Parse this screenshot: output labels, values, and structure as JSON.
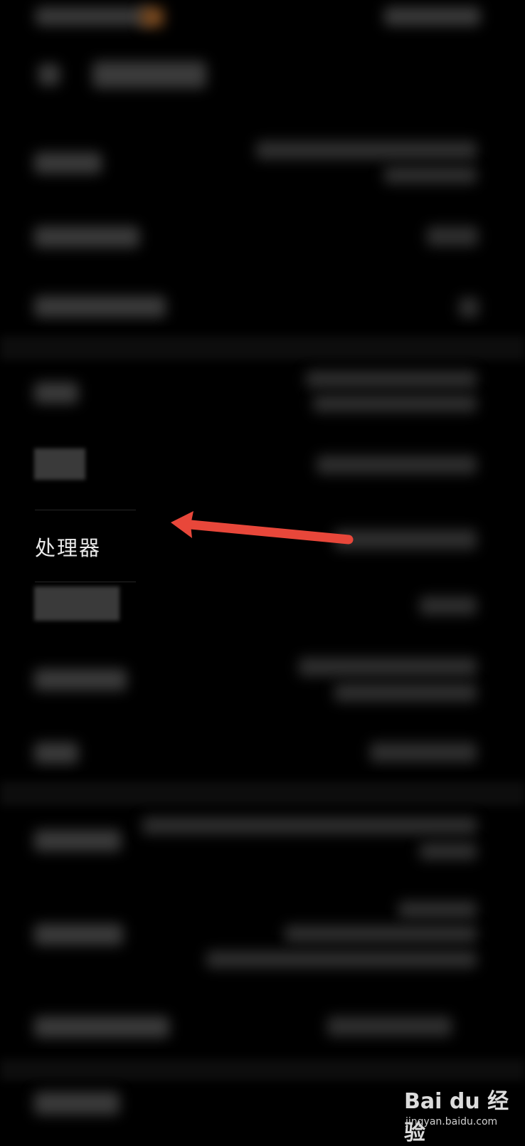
{
  "screen": {
    "highlighted_item": {
      "label": "处理器"
    }
  },
  "annotation": {
    "arrow_color": "#e8473a",
    "icon": "arrow-left-icon"
  },
  "watermark": {
    "logo": "Bai du 经验",
    "url": "jingyan.baidu.com"
  }
}
